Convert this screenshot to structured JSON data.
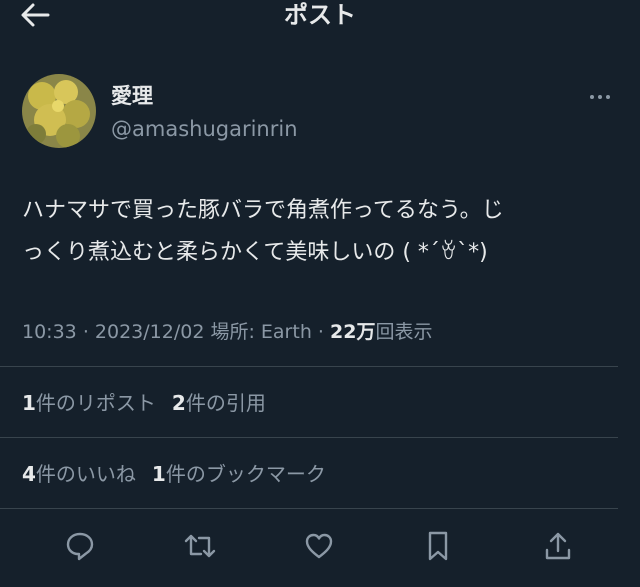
{
  "header": {
    "title": "ポスト",
    "back_icon": "arrow-left-icon"
  },
  "author": {
    "name": "愛理",
    "handle": "@amashugarinrin"
  },
  "post": {
    "text_line1": "ハナマサで買った豚バラで角煮作ってるなう。じ",
    "text_line2": "っくり煮込むと柔らかくて美味しいの ( *´ꈊ`*)"
  },
  "meta": {
    "time": "10:33",
    "date": "2023/12/02",
    "location_label": "場所: Earth",
    "views_count": "22万",
    "views_label": "回表示",
    "separator": "·"
  },
  "stats_row1": {
    "reposts_count": "1",
    "reposts_label": "件のリポスト",
    "quotes_count": "2",
    "quotes_label": "件の引用"
  },
  "stats_row2": {
    "likes_count": "4",
    "likes_label": "件のいいね",
    "bookmarks_count": "1",
    "bookmarks_label": "件のブックマーク"
  },
  "actions": [
    "reply-icon",
    "repost-icon",
    "like-icon",
    "bookmark-icon",
    "share-icon"
  ],
  "colors": {
    "background": "#15202b",
    "text": "#e7e9ea",
    "muted": "#8b98a5",
    "divider": "#38444d"
  }
}
